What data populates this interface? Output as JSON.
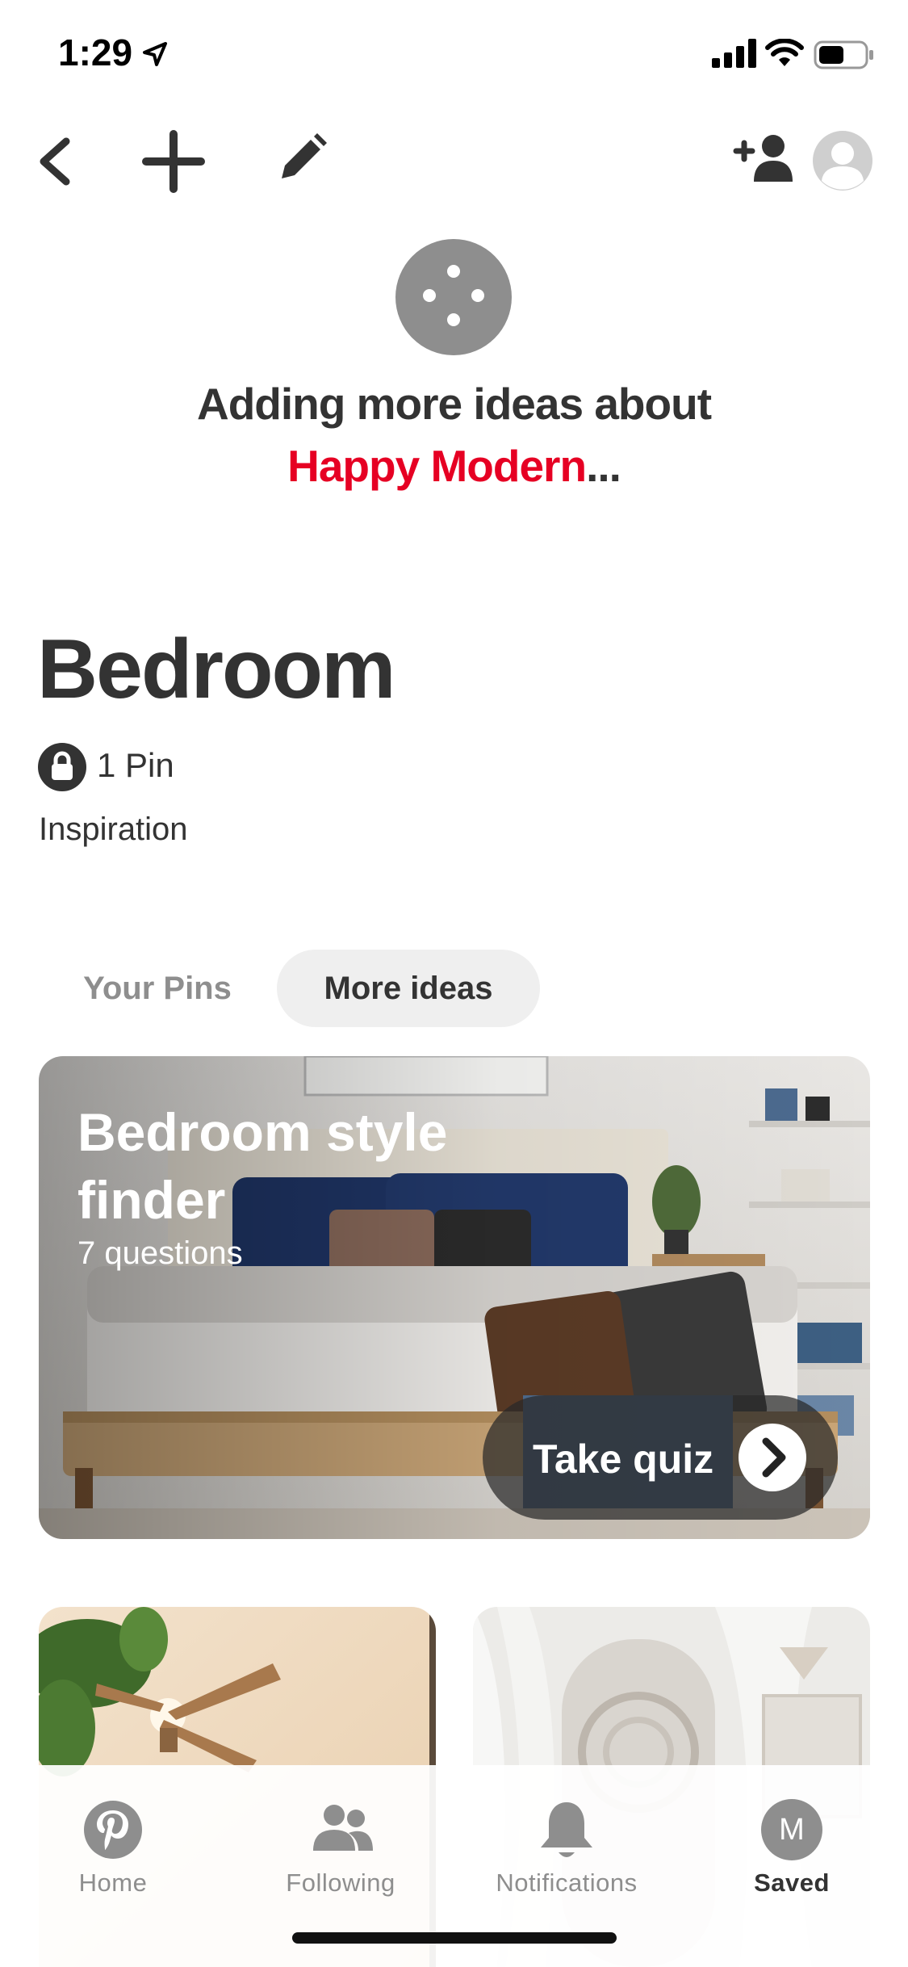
{
  "status_bar": {
    "time": "1:29"
  },
  "toolbar": {
    "back_icon": "chevron-left-icon",
    "add_icon": "plus-icon",
    "edit_icon": "pencil-icon",
    "collaborator_icon": "add-person-icon",
    "avatar_icon": "default-avatar-icon"
  },
  "loading": {
    "line1": "Adding more ideas about",
    "topic": "Happy Modern",
    "ellipsis": "..."
  },
  "board": {
    "title": "Bedroom",
    "pin_count": "1 Pin",
    "description": "Inspiration"
  },
  "tabs": [
    {
      "label": "Your Pins",
      "selected": false
    },
    {
      "label": "More ideas",
      "selected": true
    }
  ],
  "quiz": {
    "title": "Bedroom style finder",
    "subtitle": "7 questions",
    "button_label": "Take quiz"
  },
  "bottom_nav": {
    "items": [
      {
        "label": "Home",
        "icon": "pinterest-logo-icon",
        "active": false
      },
      {
        "label": "Following",
        "icon": "people-icon",
        "active": false
      },
      {
        "label": "Notifications",
        "icon": "bell-icon",
        "active": false
      },
      {
        "label": "Saved",
        "icon": "avatar-icon",
        "active": true
      }
    ],
    "saved_avatar_letter": "M"
  },
  "colors": {
    "brand_red": "#e60023",
    "text_dark": "#333333",
    "text_muted": "#8e8e8e",
    "tab_pill": "#efefef"
  }
}
